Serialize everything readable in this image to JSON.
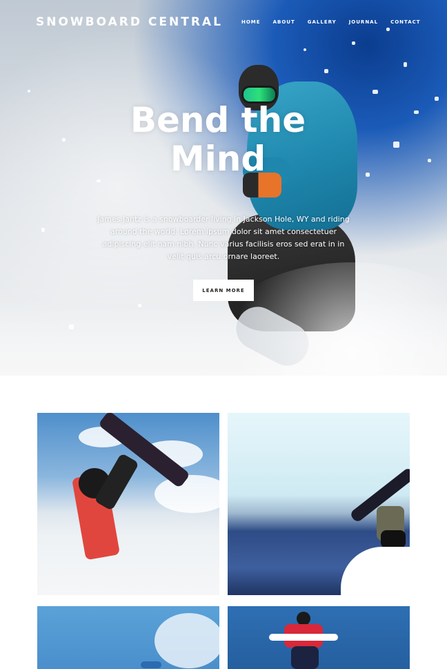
{
  "site": {
    "brand": "SNOWBOARD CENTRAL"
  },
  "nav": {
    "items": [
      "HOME",
      "ABOUT",
      "GALLERY",
      "JOURNAL",
      "CONTACT"
    ]
  },
  "hero": {
    "title": "Bend the Mind",
    "body": "James Jantz is a snowboarder living in Jackson Hole, WY and riding around the world. Lorem ipsum dolor sit amet consectetuer adipiscing elit nam nibh. Nunc varius facilisis eros sed erat in in velit quis arcu ornare laoreet.",
    "button_label": "LEARN MORE"
  },
  "colors": {
    "jacket": "#1f87ad",
    "sky_dark": "#0b3d8f",
    "button_bg": "#ffffff"
  }
}
